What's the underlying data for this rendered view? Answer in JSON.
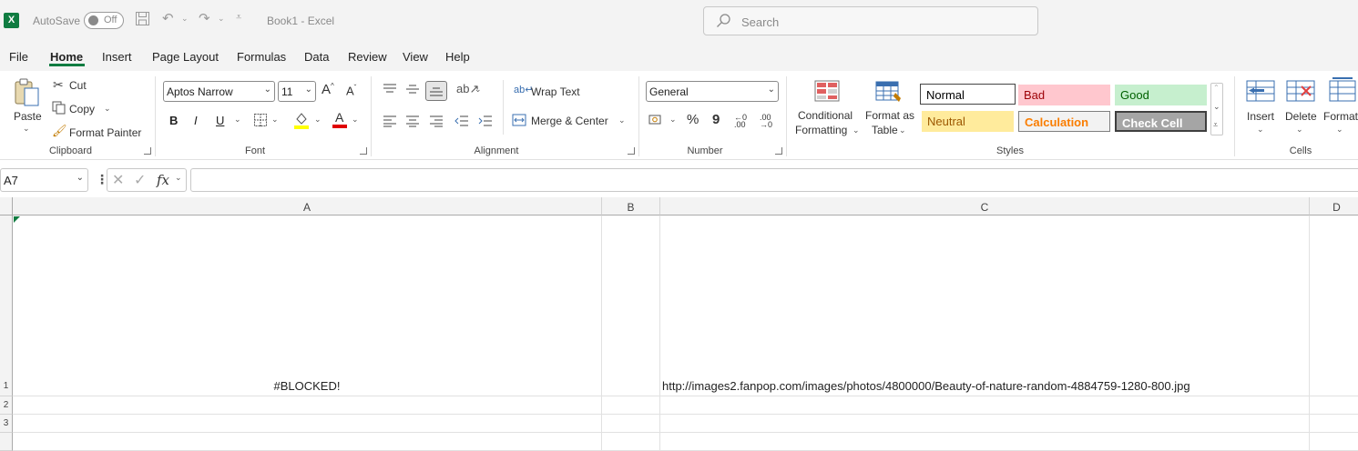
{
  "titlebar": {
    "autosave_label": "AutoSave",
    "autosave_state": "Off",
    "doc_title": "Book1  -  Excel",
    "search_placeholder": "Search"
  },
  "menu": [
    "File",
    "Home",
    "Insert",
    "Page Layout",
    "Formulas",
    "Data",
    "Review",
    "View",
    "Help"
  ],
  "ribbon": {
    "clipboard": {
      "paste": "Paste",
      "cut": "Cut",
      "copy": "Copy",
      "format_painter": "Format Painter",
      "title": "Clipboard"
    },
    "font": {
      "name": "Aptos Narrow",
      "size": "11",
      "bold": "B",
      "italic": "I",
      "underline": "U",
      "title": "Font"
    },
    "alignment": {
      "wrap_text": "Wrap Text",
      "merge_center": "Merge & Center",
      "title": "Alignment"
    },
    "number": {
      "format": "General",
      "percent": "%",
      "comma": "9",
      "title": "Number"
    },
    "styles": {
      "conditional_formatting_1": "Conditional",
      "conditional_formatting_2": "Formatting",
      "format_table_1": "Format as",
      "format_table_2": "Table",
      "normal": "Normal",
      "bad": "Bad",
      "good": "Good",
      "neutral": "Neutral",
      "calculation": "Calculation",
      "check_cell": "Check Cell",
      "title": "Styles"
    },
    "cells": {
      "insert": "Insert",
      "delete": "Delete",
      "format": "Format",
      "title": "Cells"
    }
  },
  "formula_bar": {
    "name_box": "A7",
    "formula": ""
  },
  "sheet": {
    "columns": [
      "A",
      "B",
      "C",
      "D"
    ],
    "rows": [
      {
        "num": "1",
        "a": "#BLOCKED!",
        "b": "",
        "c": "http://images2.fanpop.com/images/photos/4800000/Beauty-of-nature-random-4884759-1280-800.jpg"
      },
      {
        "num": "2",
        "a": "",
        "b": "",
        "c": ""
      },
      {
        "num": "3",
        "a": "",
        "b": "",
        "c": ""
      }
    ]
  },
  "colors": {
    "accent": "#107c41",
    "bad_bg": "#ffc7ce",
    "bad_fg": "#9c0006",
    "good_bg": "#c6efce",
    "good_fg": "#006100",
    "neutral_bg": "#ffeb9c",
    "neutral_fg": "#9c5700",
    "calc_fg": "#fa7d00",
    "check_bg": "#a5a5a5"
  }
}
